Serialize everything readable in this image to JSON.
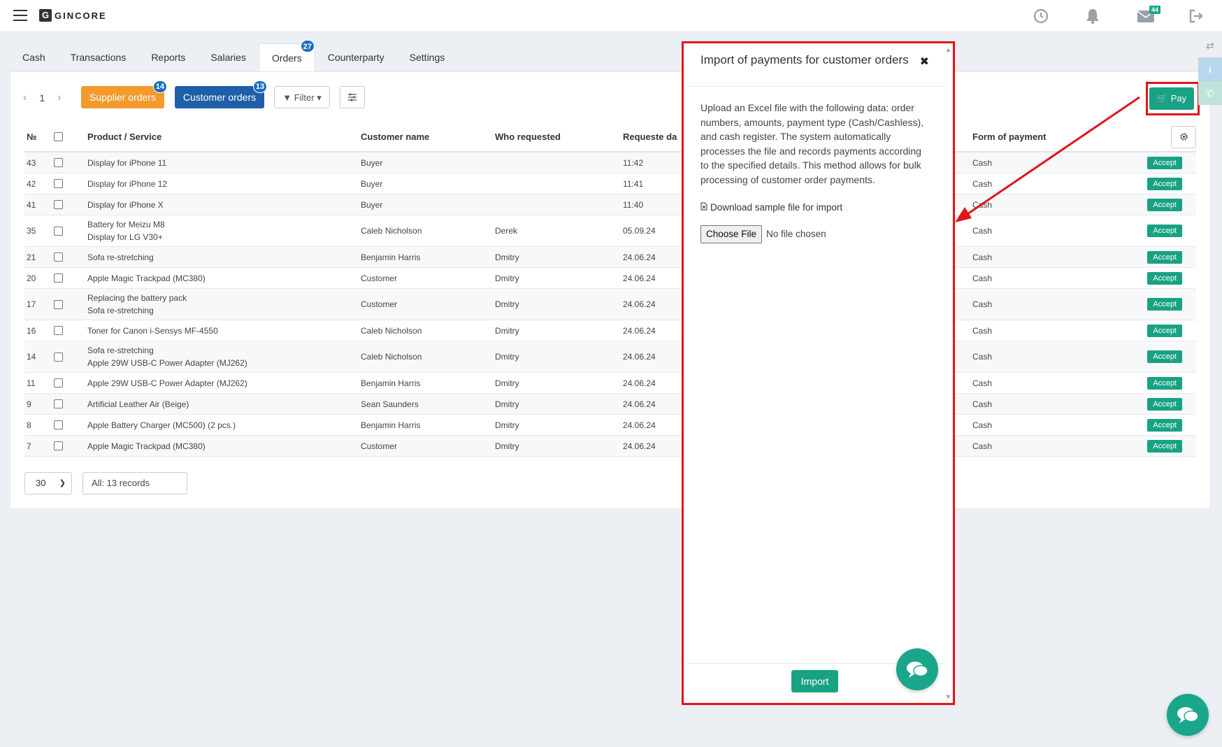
{
  "app": {
    "logo_letter": "G",
    "logo_text": "GINCORE"
  },
  "header": {
    "mail_count": "44"
  },
  "tabs": [
    {
      "label": "Cash"
    },
    {
      "label": "Transactions"
    },
    {
      "label": "Reports"
    },
    {
      "label": "Salaries"
    },
    {
      "label": "Orders",
      "badge": "27",
      "active": true
    },
    {
      "label": "Counterparty"
    },
    {
      "label": "Settings"
    }
  ],
  "toolbar": {
    "page": "1",
    "supplier_orders_label": "Supplier orders",
    "supplier_orders_badge": "14",
    "customer_orders_label": "Customer orders",
    "customer_orders_badge": "13",
    "filter_label": "Filter",
    "pay_label": "Pay"
  },
  "table": {
    "headers": {
      "no": "№",
      "product": "Product / Service",
      "customer": "Customer name",
      "who": "Who requested",
      "date": "Requeste da",
      "form": "Form of payment"
    },
    "accept_label": "Accept",
    "rows": [
      {
        "no": "43",
        "product": [
          "Display for iPhone 11"
        ],
        "customer": "Buyer",
        "who": "",
        "date": "11:42",
        "form": "Cash"
      },
      {
        "no": "42",
        "product": [
          "Display for iPhone 12"
        ],
        "customer": "Buyer",
        "who": "",
        "date": "11:41",
        "form": "Cash"
      },
      {
        "no": "41",
        "product": [
          "Display for iPhone X"
        ],
        "customer": "Buyer",
        "who": "",
        "date": "11:40",
        "form": "Cash"
      },
      {
        "no": "35",
        "product": [
          "Battery for Meizu M8",
          "Display for LG V30+"
        ],
        "customer": "Caleb Nicholson",
        "who": "Derek",
        "date": "05.09.24",
        "form": "Cash"
      },
      {
        "no": "21",
        "product": [
          "Sofa re-stretching"
        ],
        "customer": "Benjamin Harris",
        "who": "Dmitry",
        "date": "24.06.24",
        "form": "Cash"
      },
      {
        "no": "20",
        "product": [
          "Apple Magic Trackpad (MC380)"
        ],
        "customer": "Customer",
        "who": "Dmitry",
        "date": "24.06.24",
        "form": "Cash"
      },
      {
        "no": "17",
        "product": [
          "Replacing the battery pack",
          "Sofa re-stretching"
        ],
        "customer": "Customer",
        "who": "Dmitry",
        "date": "24.06.24",
        "form": "Cash"
      },
      {
        "no": "16",
        "product": [
          "Toner for Canon i-Sensys MF-4550"
        ],
        "customer": "Caleb Nicholson",
        "who": "Dmitry",
        "date": "24.06.24",
        "form": "Cash"
      },
      {
        "no": "14",
        "product": [
          "Sofa re-stretching",
          "Apple 29W USB-C Power Adapter (MJ262)"
        ],
        "customer": "Caleb Nicholson",
        "who": "Dmitry",
        "date": "24.06.24",
        "form": "Cash"
      },
      {
        "no": "11",
        "product": [
          "Apple 29W USB-C Power Adapter (MJ262)"
        ],
        "customer": "Benjamin Harris",
        "who": "Dmitry",
        "date": "24.06.24",
        "form": "Cash"
      },
      {
        "no": "9",
        "product": [
          "Artificial Leather Air (Beige)"
        ],
        "customer": "Sean Saunders",
        "who": "Dmitry",
        "date": "24.06.24",
        "form": "Cash"
      },
      {
        "no": "8",
        "product": [
          "Apple Battery Charger (MC500) (2 pcs.)"
        ],
        "customer": "Benjamin Harris",
        "who": "Dmitry",
        "date": "24.06.24",
        "form": "Cash"
      },
      {
        "no": "7",
        "product": [
          "Apple Magic Trackpad (MC380)"
        ],
        "customer": "Customer",
        "who": "Dmitry",
        "date": "24.06.24",
        "form": "Cash"
      }
    ]
  },
  "footer": {
    "page_size": "30",
    "records_text": "All: 13 records"
  },
  "modal": {
    "title": "Import of payments for customer orders",
    "description": "Upload an Excel file with the following data: order numbers, amounts, payment type (Cash/Cashless), and cash register. The system automatically processes the file and records payments according to the specified details. This method allows for bulk processing of customer order payments.",
    "download_label": "Download sample file for import",
    "choose_file_label": "Choose File",
    "no_file_label": "No file chosen",
    "import_label": "Import"
  },
  "colors": {
    "accent": "#18a283",
    "orange": "#f39a2d",
    "blue": "#1f5fa8",
    "highlight": "#e3141b"
  }
}
